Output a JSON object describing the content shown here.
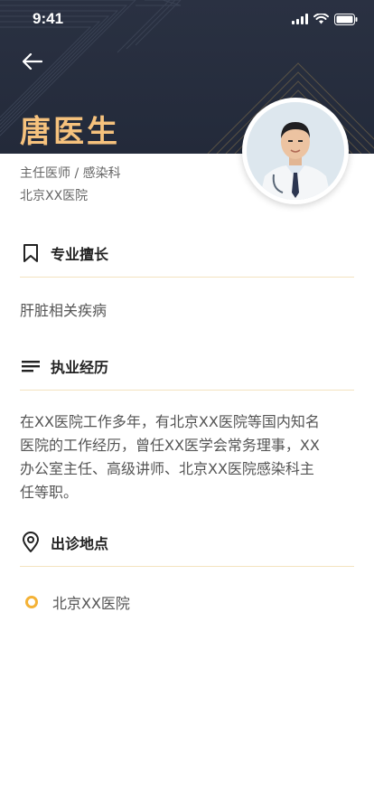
{
  "status_bar": {
    "time": "9:41"
  },
  "doctor": {
    "name": "唐医生",
    "title_department": "主任医师 / 感染科",
    "hospital": "北京XX医院"
  },
  "sections": {
    "specialty": {
      "title": "专业擅长",
      "text": "肝脏相关疾病"
    },
    "experience": {
      "title": "执业经历",
      "lines": [
        "在XX医院工作多年，有北京XX医院等国内知名",
        "医院的工作经历，曾任XX医学会常务理事，XX",
        "办公室主任、高级讲师、北京XX医院感染科主",
        "任等职。"
      ]
    },
    "location": {
      "title": "出诊地点",
      "place": "北京XX医院"
    }
  },
  "icons": {
    "back": "back-arrow-icon",
    "specialty": "bookmark-icon",
    "experience": "list-lines-icon",
    "location": "map-pin-icon"
  },
  "colors": {
    "header_bg": "#262d3d",
    "name": "#f6c27d",
    "accent": "#f4b236",
    "divider": "#f3e3bf"
  }
}
